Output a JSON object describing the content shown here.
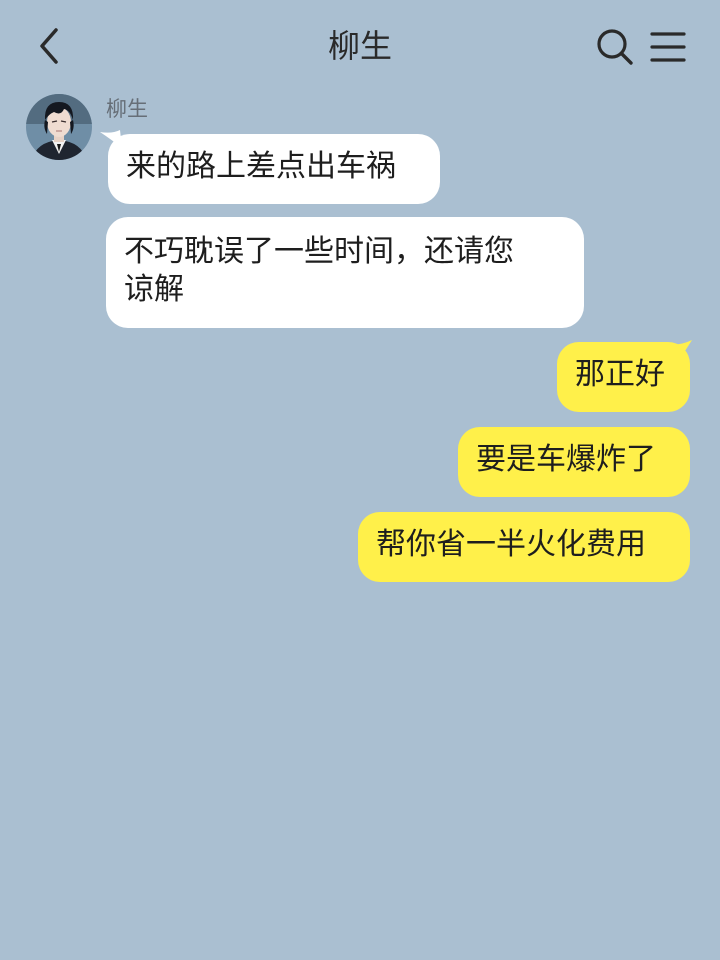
{
  "header": {
    "title": "柳生",
    "back_icon": "chevron-left-icon",
    "search_icon": "search-icon",
    "menu_icon": "hamburger-menu-icon"
  },
  "contact": {
    "name": "柳生"
  },
  "messages": [
    {
      "side": "left",
      "text": "来的路上差点出车祸"
    },
    {
      "side": "left",
      "text_line1": "不巧耽误了一些时间，还请您",
      "text_line2": "谅解"
    },
    {
      "side": "right",
      "text": "那正好"
    },
    {
      "side": "right",
      "text": "要是车爆炸了"
    },
    {
      "side": "right",
      "text": "帮你省一半火化费用"
    }
  ],
  "colors": {
    "background": "#aabfd1",
    "incoming_bubble": "#ffffff",
    "outgoing_bubble": "#fff04a"
  }
}
